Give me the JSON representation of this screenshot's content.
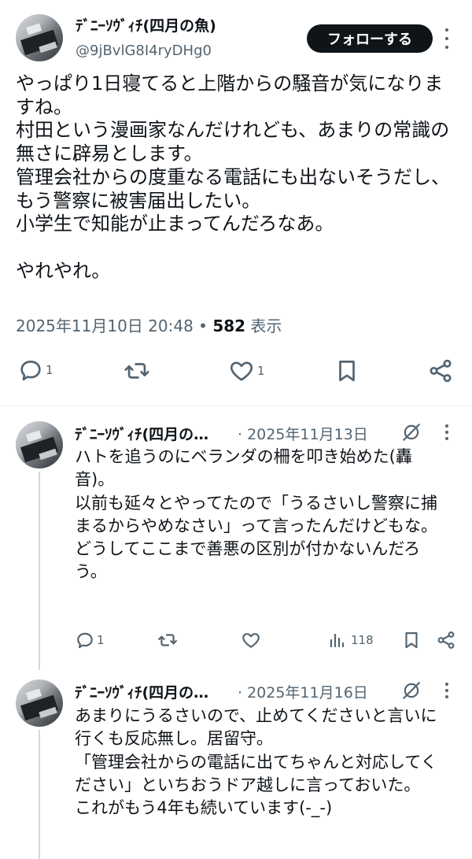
{
  "main_post": {
    "author_name": "ﾃﾞﾆｰｿｳﾞｨﾁ(四月の魚)",
    "handle": "@9jBvlG8I4ryDHg0",
    "follow_label": "フォローする",
    "text": "やっぱり1日寝てると上階からの騒音が気になりますね。\n村田という漫画家なんだけれども、あまりの常識の無さに辟易とします。\n管理会社からの度重なる電話にも出ないそうだし、もう警察に被害届出したい。\n小学生で知能が止まってんだろなあ。\n\nやれやれ。",
    "timestamp": "2025年11月10日 20:48",
    "separator": "•",
    "views_count": "582",
    "views_label": "表示",
    "reply_count": "1",
    "like_count": "1"
  },
  "replies": [
    {
      "author_name": "ﾃﾞﾆｰｿｳﾞｨﾁ(四月の…",
      "date": "· 2025年11月13日",
      "text": "ハトを追うのにベランダの柵を叩き始めた(轟音)。\n以前も延々とやってたので「うるさいし警察に捕まるからやめなさい」って言ったんだけどもな。\nどうしてここまで善悪の区別が付かないんだろう。",
      "reply_count": "1",
      "views_count": "118"
    },
    {
      "author_name": "ﾃﾞﾆｰｿｳﾞｨﾁ(四月の…",
      "date": "· 2025年11月16日",
      "text": "あまりにうるさいので、止めてくださいと言いに行くも反応無し。居留守。\n「管理会社からの電話に出てちゃんと対応してください」といちおうドア越しに言っておいた。\nこれがもう4年も続いています(-_-)"
    }
  ],
  "icons": {
    "reply": "reply-icon",
    "repost": "repost-icon",
    "like": "heart-icon",
    "bookmark": "bookmark-icon",
    "share": "share-icon",
    "views": "views-icon",
    "grok": "grok-icon",
    "more": "more-icon"
  },
  "colors": {
    "text": "#0f1419",
    "secondary": "#536471",
    "follow_bg": "#0f1419",
    "thread_line": "#cfd9de"
  }
}
